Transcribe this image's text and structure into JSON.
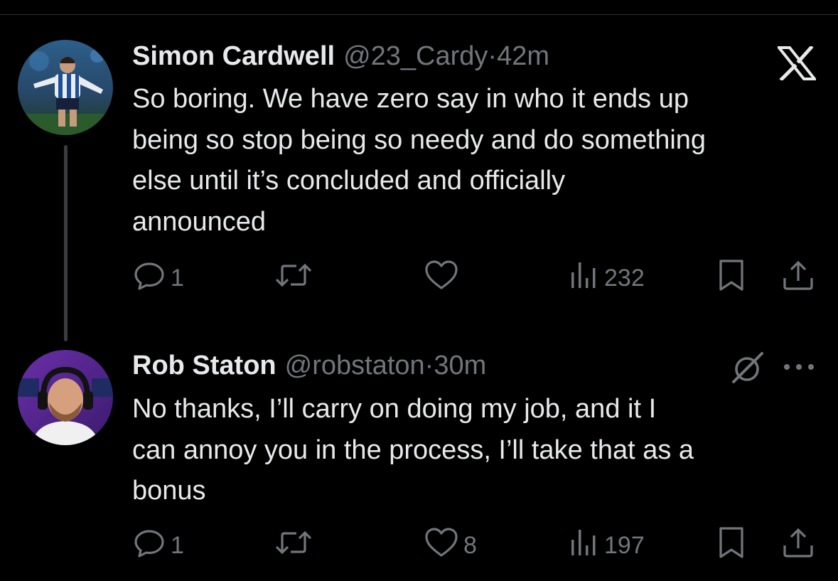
{
  "colors": {
    "background": "#000000",
    "primary_text": "#e7e9ea",
    "secondary_text": "#71767b",
    "divider": "#2f3336",
    "thread_line": "#3a3d40"
  },
  "tweets": [
    {
      "author_name": "Simon Cardwell",
      "author_handle": "@23_Cardy",
      "separator": "·",
      "time": "42m",
      "text": "So boring. We have zero say in who it ends up\nbeing so stop being so needy and do something\nelse until it’s concluded and officially\nannounced",
      "corner_icon": "x-logo-icon",
      "actions": {
        "reply_count": "1",
        "retweet_count": "",
        "like_count": "",
        "views_count": "232"
      }
    },
    {
      "author_name": "Rob Staton",
      "author_handle": "@robstaton",
      "separator": "·",
      "time": "30m",
      "text": "No thanks, I’ll carry on doing my job, and it I\ncan annoy you in the process, I’ll take that as a\nbonus",
      "corner_icon": "grok-icon",
      "actions": {
        "reply_count": "1",
        "retweet_count": "",
        "like_count": "8",
        "views_count": "197"
      }
    }
  ],
  "icons": [
    "reply-icon",
    "retweet-icon",
    "like-icon",
    "views-icon",
    "bookmark-icon",
    "share-icon",
    "more-icon"
  ]
}
